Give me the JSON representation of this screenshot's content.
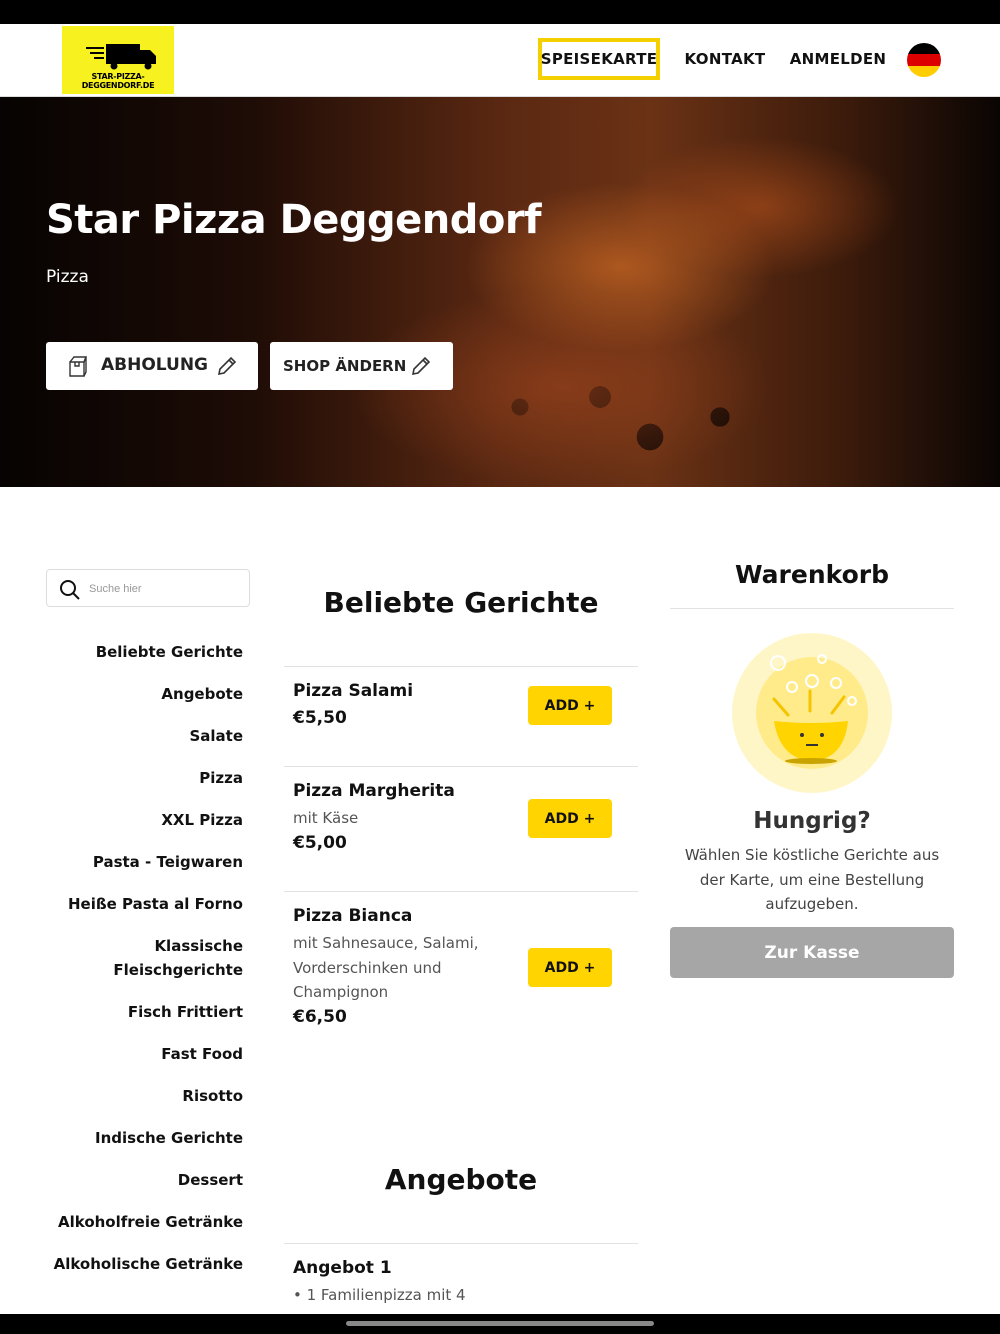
{
  "logo": {
    "text": "STAR-PIZZA-DEGGENDORF.DE",
    "icon": "delivery-truck-icon",
    "bg_color": "#f7f11f"
  },
  "nav": {
    "menu": "SPEISEKARTE",
    "contact": "KONTAKT",
    "login": "ANMELDEN",
    "language_icon": "german-flag-icon",
    "active_color": "#f5d000"
  },
  "hero": {
    "title": "Star Pizza Deggendorf",
    "subtitle": "Pizza",
    "pickup_label": "ABHOLUNG",
    "pickup_icon": "takeaway-bag-icon",
    "shop_label": "SHOP ÄNDERN",
    "edit_icon": "pencil-icon"
  },
  "search": {
    "placeholder": "Suche hier",
    "icon": "search-icon"
  },
  "categories": [
    "Beliebte Gerichte",
    "Angebote",
    "Salate",
    "Pizza",
    "XXL Pizza",
    "Pasta - Teigwaren",
    "Heiße Pasta al Forno",
    "Klassische Fleischgerichte",
    "Fisch Frittiert",
    "Fast Food",
    "Risotto",
    "Indische Gerichte",
    "Dessert",
    "Alkoholfreie Getränke",
    "Alkoholische Getränke"
  ],
  "popular": {
    "title": "Beliebte Gerichte",
    "items": [
      {
        "name": "Pizza Salami",
        "desc": "",
        "price": "€5,50",
        "button": "ADD +"
      },
      {
        "name": "Pizza Margherita",
        "desc": "mit Käse",
        "price": "€5,00",
        "button": "ADD +"
      },
      {
        "name": "Pizza Bianca",
        "desc": "mit Sahnesauce, Salami, Vorderschinken und Champignon",
        "price": "€6,50",
        "button": "ADD +"
      }
    ]
  },
  "offers": {
    "title": "Angebote",
    "items": [
      {
        "name": "Angebot 1",
        "desc": "• 1 Familienpizza mit 4"
      }
    ]
  },
  "cart": {
    "title": "Warenkorb",
    "empty_title": "Hungrig?",
    "empty_text": "Wählen Sie köstliche Gerichte aus der Karte, um eine Bestellung aufzugeben.",
    "checkout": "Zur Kasse",
    "illustration_icon": "empty-bowl-icon",
    "accent_color": "#ffd400"
  }
}
